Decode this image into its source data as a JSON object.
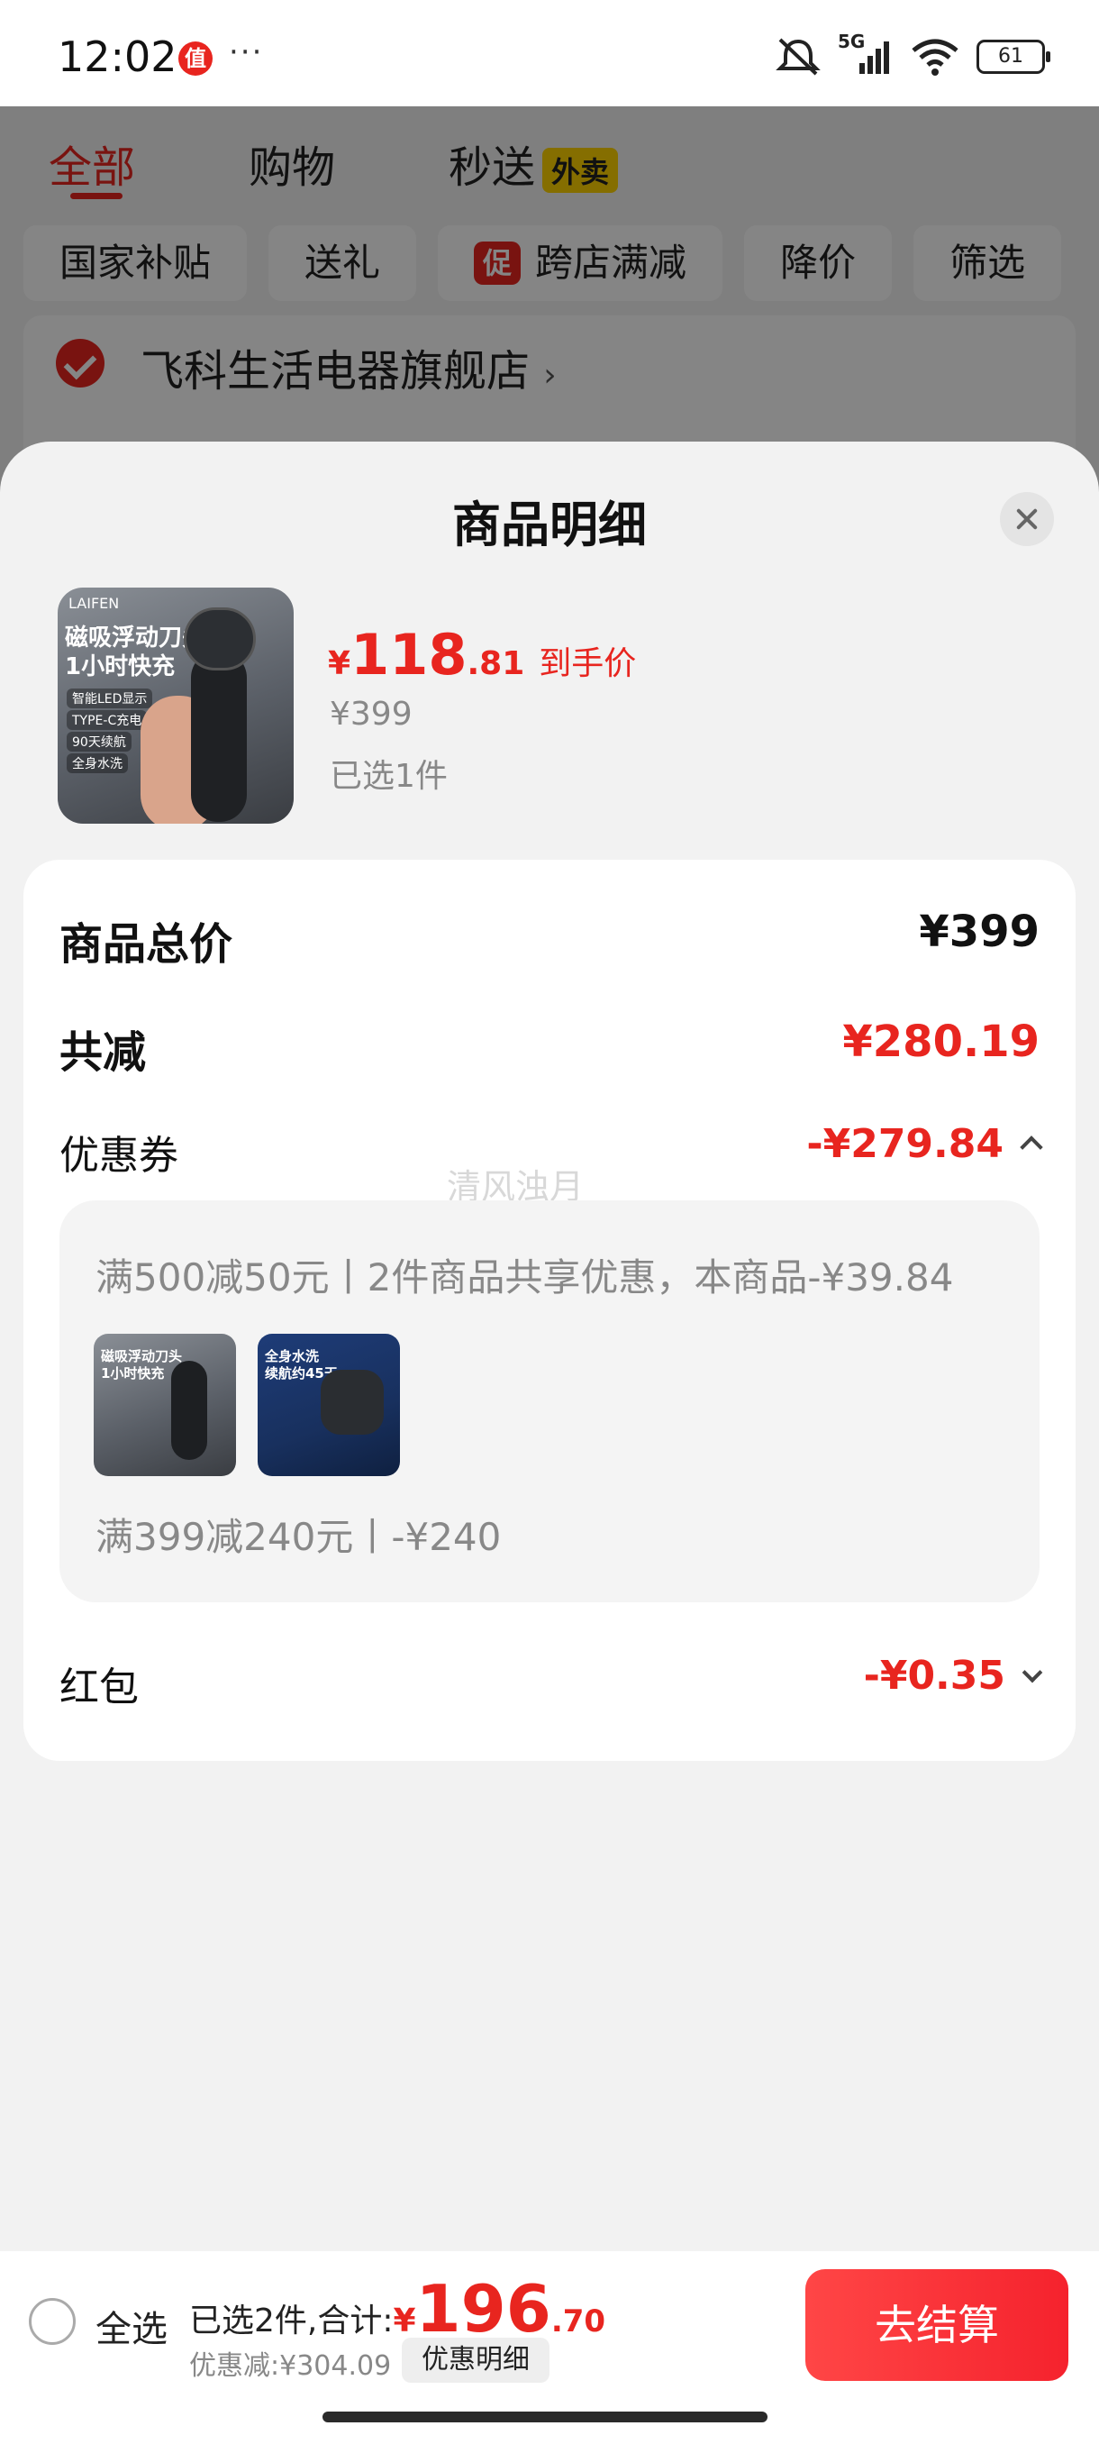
{
  "status_bar": {
    "time": "12:02",
    "app_badge": "值",
    "more": "···",
    "network": "5G",
    "battery": "61",
    "icons": [
      "mute-icon",
      "signal-icon",
      "wifi-icon",
      "battery-icon"
    ]
  },
  "background_page": {
    "tabs": [
      {
        "label": "全部",
        "active": true
      },
      {
        "label": "购物",
        "active": false
      },
      {
        "label": "秒送",
        "active": false,
        "badge": "外卖"
      }
    ],
    "chips": [
      {
        "label": "国家补贴"
      },
      {
        "label": "送礼"
      },
      {
        "label": "跨店满减",
        "badge": "促"
      },
      {
        "label": "降价"
      },
      {
        "label": "筛选"
      }
    ],
    "store_name": "飞科生活电器旗舰店",
    "store_arrow": "›"
  },
  "sheet": {
    "title": "商品明细",
    "product": {
      "thumb_brand": "LAIFEN",
      "thumb_headline": "磁吸浮动刀头\n1小时快充",
      "thumb_features": [
        "智能LED显示",
        "TYPE-C充电",
        "90天续航",
        "全身水洗"
      ],
      "price_symbol": "¥",
      "price_int": "118",
      "price_dec": ".81",
      "price_tag": "到手价",
      "original_price": "¥399",
      "selected": "已选1件"
    },
    "summary": {
      "total_label": "商品总价",
      "total_value": "¥399",
      "reduce_label": "共减",
      "reduce_value": "¥280.19",
      "coupon_label": "优惠券",
      "coupon_value": "-¥279.84",
      "watermark": "清风浊月",
      "coupon_line1": "满500减50元丨2件商品共享优惠，本商品-¥39.84",
      "mini1_text": "磁吸浮动刀头\n1小时快充",
      "mini2_text": "全身水洗\n续航约45天",
      "coupon_line2": "满399减240元丨-¥240",
      "hongbao_label": "红包",
      "hongbao_value": "-¥0.35"
    }
  },
  "bottom_bar": {
    "select_all": "全选",
    "summary_prefix": "已选2件,合计:",
    "total_symbol": "¥",
    "total_int": "196",
    "total_dec": ".70",
    "discount": "优惠减:¥304.09",
    "detail_button": "优惠明细",
    "checkout_button": "去结算"
  },
  "colors": {
    "accent_red": "#e8251f",
    "badge_yellow": "#ffd400"
  }
}
